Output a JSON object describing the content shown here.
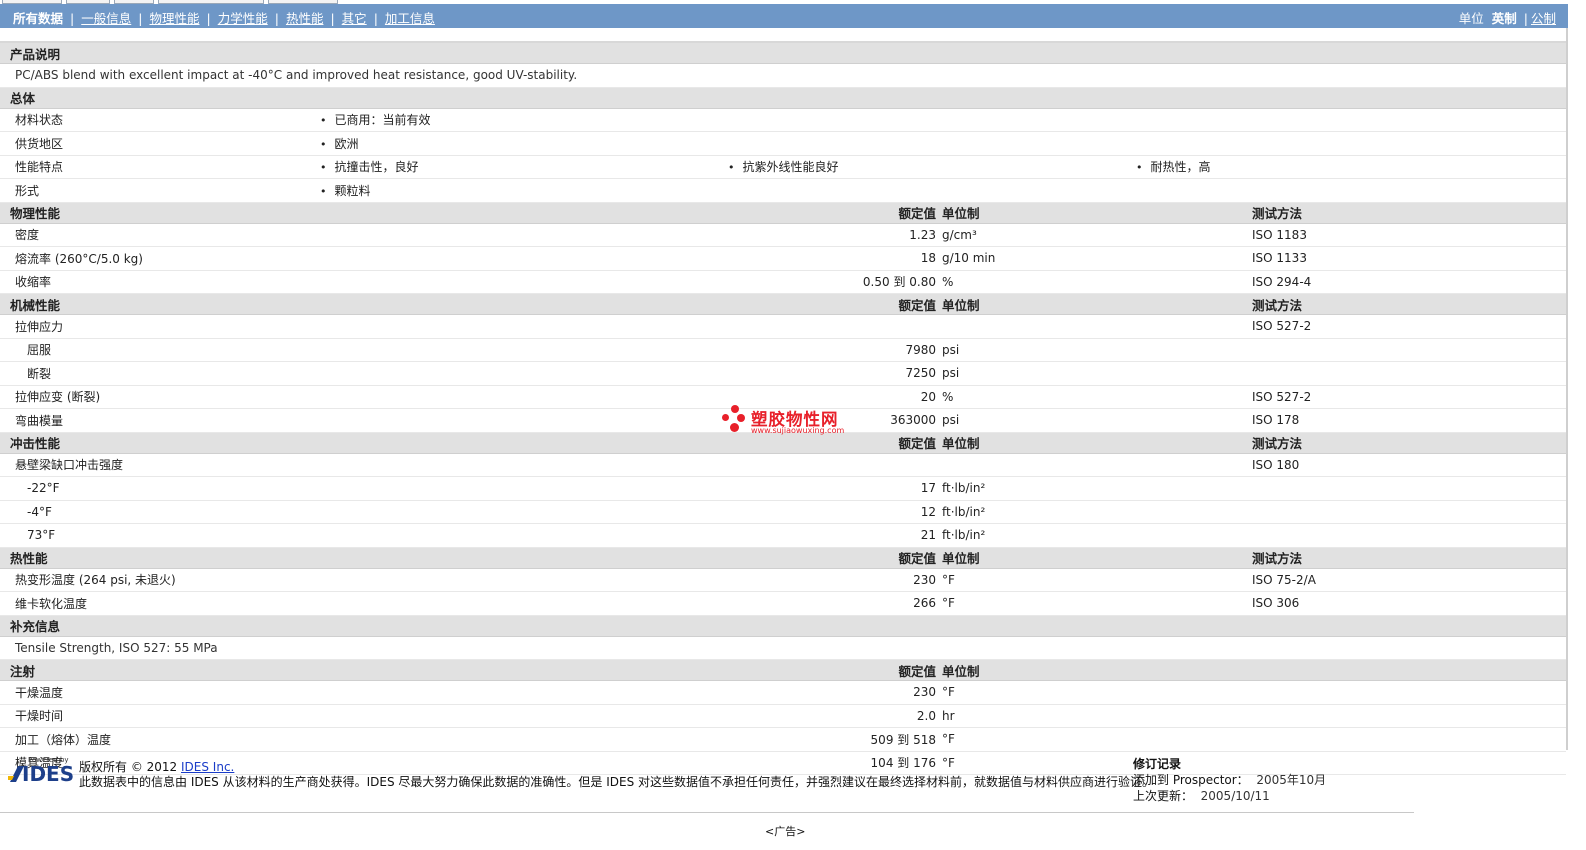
{
  "nav": {
    "tabs": [
      "所有数据",
      "一般信息",
      "物理性能",
      "力学性能",
      "热性能",
      "其它",
      "加工信息"
    ],
    "units_label": "单位",
    "units_active": "英制",
    "units_other": "公制"
  },
  "sections": {
    "description": {
      "title": "产品说明",
      "text": "PC/ABS blend with excellent impact at -40°C and improved heat resistance, good UV-stability."
    },
    "general": {
      "title": "总体",
      "rows": [
        {
          "label": "材料状态",
          "items": [
            "已商用：当前有效"
          ]
        },
        {
          "label": "供货地区",
          "items": [
            "欧洲"
          ]
        },
        {
          "label": "性能特点",
          "items": [
            "抗撞击性，良好",
            "抗紫外线性能良好",
            "耐热性，高"
          ]
        },
        {
          "label": "形式",
          "items": [
            "颗粒料"
          ]
        }
      ]
    },
    "headers": {
      "value": "额定值",
      "unit": "单位制",
      "method": "测试方法"
    },
    "physical": {
      "title": "物理性能",
      "rows": [
        {
          "label": "密度",
          "value": "1.23",
          "unit": "g/cm³",
          "method": "ISO 1183"
        },
        {
          "label": "熔流率  (260°C/5.0 kg)",
          "value": "18",
          "unit": "g/10 min",
          "method": "ISO 1133"
        },
        {
          "label": "收缩率",
          "value": "0.50 到  0.80",
          "unit": "%",
          "method": "ISO 294-4"
        }
      ]
    },
    "mechanical": {
      "title": "机械性能",
      "rows": [
        {
          "label": "拉伸应力",
          "value": "",
          "unit": "",
          "method": "ISO 527-2"
        },
        {
          "label": "屈服",
          "value": "7980",
          "unit": "psi",
          "method": ""
        },
        {
          "label": "断裂",
          "value": "7250",
          "unit": "psi",
          "method": ""
        },
        {
          "label": "拉伸应变  (断裂)",
          "value": "20",
          "unit": "%",
          "method": "ISO 527-2"
        },
        {
          "label": "弯曲模量",
          "value": "363000",
          "unit": "psi",
          "method": "ISO 178"
        }
      ]
    },
    "impact": {
      "title": "冲击性能",
      "rows": [
        {
          "label": "悬壁梁缺口冲击强度",
          "value": "",
          "unit": "",
          "method": "ISO 180"
        },
        {
          "label": "-22°F",
          "value": "17",
          "unit": "ft·lb/in²",
          "method": ""
        },
        {
          "label": "-4°F",
          "value": "12",
          "unit": "ft·lb/in²",
          "method": ""
        },
        {
          "label": "73°F",
          "value": "21",
          "unit": "ft·lb/in²",
          "method": ""
        }
      ]
    },
    "thermal": {
      "title": "热性能",
      "rows": [
        {
          "label": "热变形温度  (264 psi, 未退火)",
          "value": "230",
          "unit": "°F",
          "method": "ISO 75-2/A"
        },
        {
          "label": "维卡软化温度",
          "value": "266",
          "unit": "°F",
          "method": "ISO 306"
        }
      ]
    },
    "supplement": {
      "title": "补充信息",
      "text": "Tensile Strength, ISO 527: 55 MPa"
    },
    "injection": {
      "title": "注射",
      "rows": [
        {
          "label": "干燥温度",
          "value": "230",
          "unit": "°F"
        },
        {
          "label": "干燥时间",
          "value": "2.0",
          "unit": "hr"
        },
        {
          "label": "加工（熔体）温度",
          "value": "509 到  518",
          "unit": "°F"
        },
        {
          "label": "模具温度",
          "value": "104 到  176",
          "unit": "°F"
        }
      ]
    }
  },
  "watermark": {
    "brand": "塑胶物性网",
    "url": "www.sujiaowuxing.com"
  },
  "footer": {
    "logo_powered": "Powered by",
    "logo_text": "IDES",
    "copyright_prefix": "版权所有  © 2012",
    "copyright_link": "IDES Inc.",
    "disclaimer": "此数据表中的信息由  IDES 从该材料的生产商处获得。IDES 尽最大努力确保此数据的准确性。但是  IDES 对这些数据值不承担任何责任，并强烈建议在最终选择材料前，就数据值与材料供应商进行验证。",
    "revision_title": "修订记录",
    "added_label": "添加到  Prospector：",
    "added_value": "2005年10月",
    "updated_label": "上次更新：",
    "updated_value": "2005/10/11",
    "ad_text": "<广告>"
  },
  "colors": {
    "nav_bg": "#6e97c7",
    "section_bg": "#e1e1e1",
    "watermark_red": "#e8202a",
    "link_blue": "#1a3cc8"
  }
}
